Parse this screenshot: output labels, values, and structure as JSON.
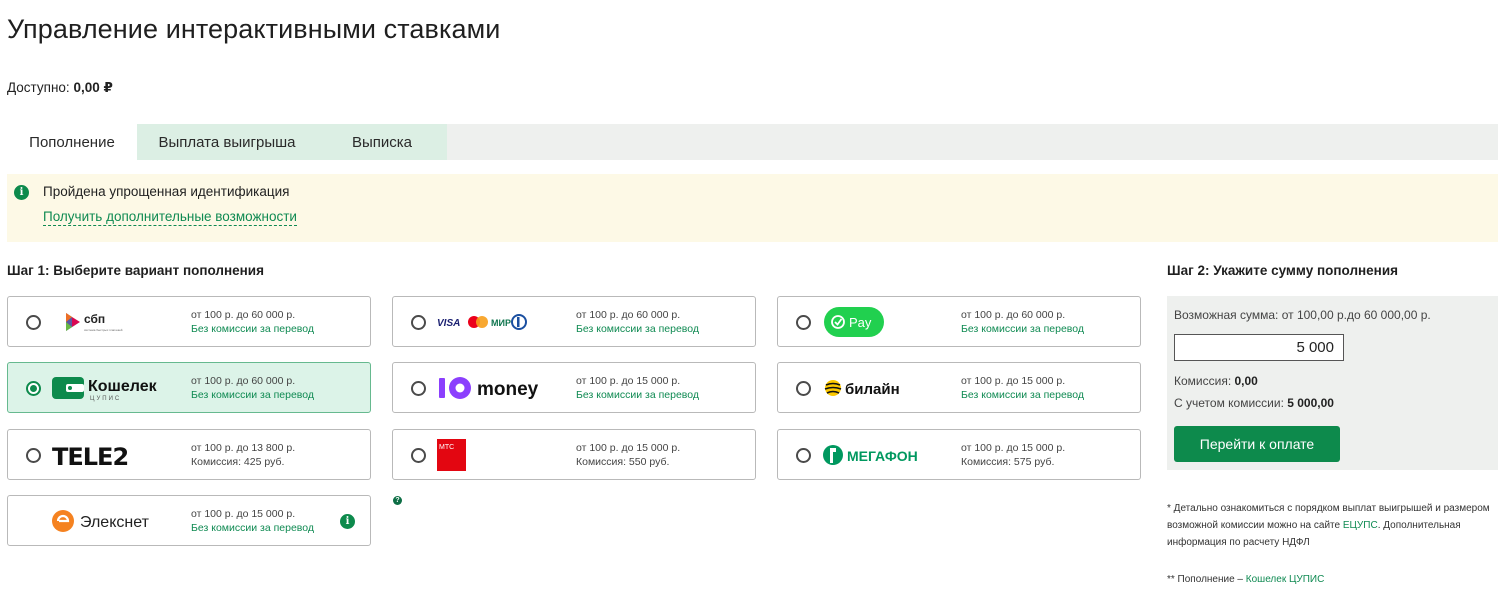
{
  "page": {
    "title": "Управление интерактивными ставками",
    "balance_label": "Доступно:",
    "balance_value": "0,00 ₽"
  },
  "tabs": [
    {
      "label": "Пополнение",
      "active": true
    },
    {
      "label": "Выплата выигрыша",
      "active": false
    },
    {
      "label": "Выписка",
      "active": false
    }
  ],
  "notice": {
    "text": "Пройдена упрощенная идентификация",
    "link": "Получить дополнительные возможности"
  },
  "step1": {
    "title": "Шаг 1: Выберите вариант пополнения"
  },
  "methods": [
    {
      "logo_text": "сбп",
      "logo_sub": "система быстрых платежей",
      "limits": "от 100 р. до 60 000 р.",
      "fee": "Без комиссии за перевод",
      "selected": false
    },
    {
      "logo_text": "VISA",
      "logo_sub": "МИР",
      "limits": "от 100 р. до 60 000 р.",
      "fee": "Без комиссии за перевод",
      "selected": false
    },
    {
      "logo_text": "Pay",
      "limits": "от 100 р. до 60 000 р.",
      "fee": "Без комиссии за перевод",
      "selected": false
    },
    {
      "logo_text": "Кошелек",
      "logo_sub": "ЦУПИС",
      "limits": "от 100 р. до 60 000 р.",
      "fee": "Без комиссии за перевод",
      "selected": true
    },
    {
      "logo_text": "money",
      "limits": "от 100 р. до 15 000 р.",
      "fee": "Без комиссии за перевод",
      "selected": false
    },
    {
      "logo_text": "билайн",
      "limits": "от 100 р. до 15 000 р.",
      "fee": "Без комиссии за перевод",
      "selected": false
    },
    {
      "logo_text": "TELE2",
      "limits": "от 100 р. до 13 800 р.",
      "fee": "Комиссия: 425 руб.",
      "selected": false
    },
    {
      "logo_text": "МТС",
      "limits": "от 100 р. до 15 000 р.",
      "fee": "Комиссия: 550 руб.",
      "selected": false
    },
    {
      "logo_text": "МЕГАФОН",
      "limits": "от 100 р. до 15 000 р.",
      "fee": "Комиссия: 575 руб.",
      "selected": false
    },
    {
      "logo_text": "Элекснет",
      "limits": "от 100 р. до 15 000 р.",
      "fee": "Без комиссии за перевод",
      "selected": false
    }
  ],
  "step2": {
    "title": "Шаг 2: Укажите сумму пополнения",
    "range": "Возможная сумма: от 100,00 р.до 60 000,00 р.",
    "amount": "5 000",
    "commission_label": "Комиссия:",
    "commission_value": "0,00",
    "with_commission_label": "С учетом комиссии:",
    "with_commission_value": "5 000,00",
    "pay_button": "Перейти к оплате"
  },
  "footnotes": {
    "part1": "* Детально ознакомиться с порядком выплат выигрышей и размером возможной комиссии можно на сайте ",
    "link1": "ЕЦУПС",
    "part2": ". Дополнительная информация по расчету НДФЛ",
    "second_prefix": "** Пополнение – ",
    "second_link": "Кошелек ЦУПИС"
  },
  "colors": {
    "accent": "#0d8a4c",
    "link": "#0f8a52",
    "tab_bg": "#dcefe4",
    "notice_bg": "#fdf9e6",
    "selected_bg": "#dcf3e8"
  }
}
